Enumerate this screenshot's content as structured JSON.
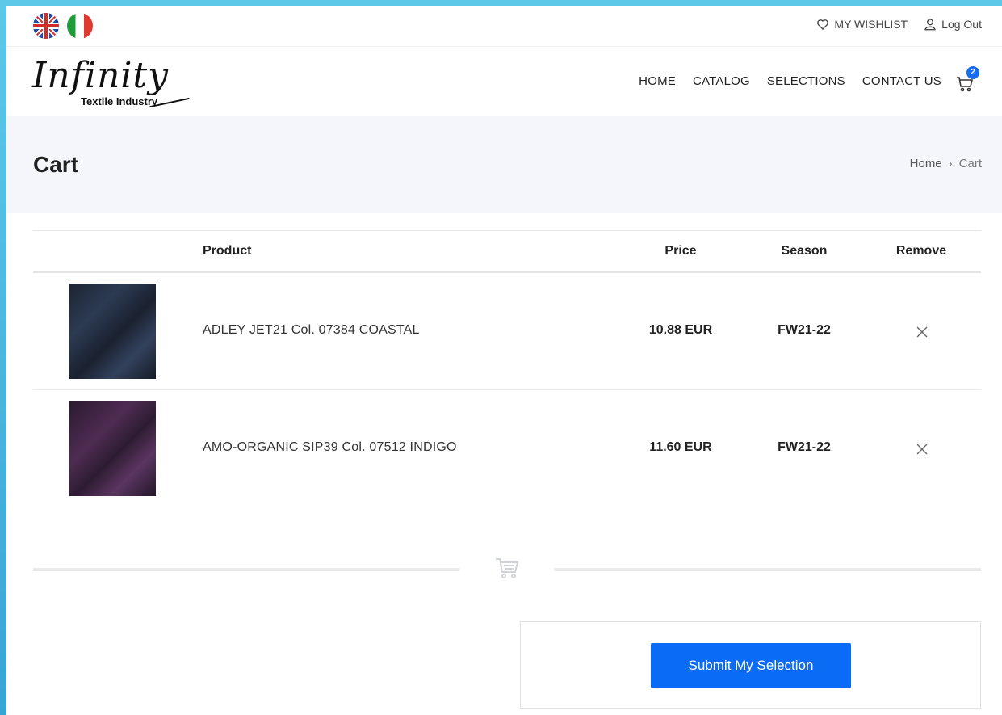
{
  "topbar": {
    "wishlist_label": "MY WISHLIST",
    "logout_label": "Log Out"
  },
  "logo": {
    "name": "Infinity",
    "tagline": "Textile Industry"
  },
  "nav": {
    "items": [
      {
        "label": "HOME"
      },
      {
        "label": "CATALOG"
      },
      {
        "label": "SELECTIONS"
      },
      {
        "label": "CONTACT US"
      }
    ],
    "cart_count": "2"
  },
  "page": {
    "title": "Cart",
    "breadcrumb_home": "Home",
    "breadcrumb_sep": "›",
    "breadcrumb_current": "Cart"
  },
  "table": {
    "headers": {
      "product": "Product",
      "price": "Price",
      "season": "Season",
      "remove": "Remove"
    },
    "rows": [
      {
        "name": "ADLEY JET21 Col. 07384 COASTAL",
        "price": "10.88 EUR",
        "season": "FW21-22",
        "swatch_color": "#1f2a3c"
      },
      {
        "name": "AMO-ORGANIC SIP39 Col. 07512 INDIGO",
        "price": "11.60 EUR",
        "season": "FW21-22",
        "swatch_color": "#4a2a4e"
      }
    ]
  },
  "actions": {
    "submit_label": "Submit My Selection"
  },
  "colors": {
    "accent": "#0a6cf5",
    "title_band": "#f4f6fb",
    "badge": "#1a6cf0"
  }
}
